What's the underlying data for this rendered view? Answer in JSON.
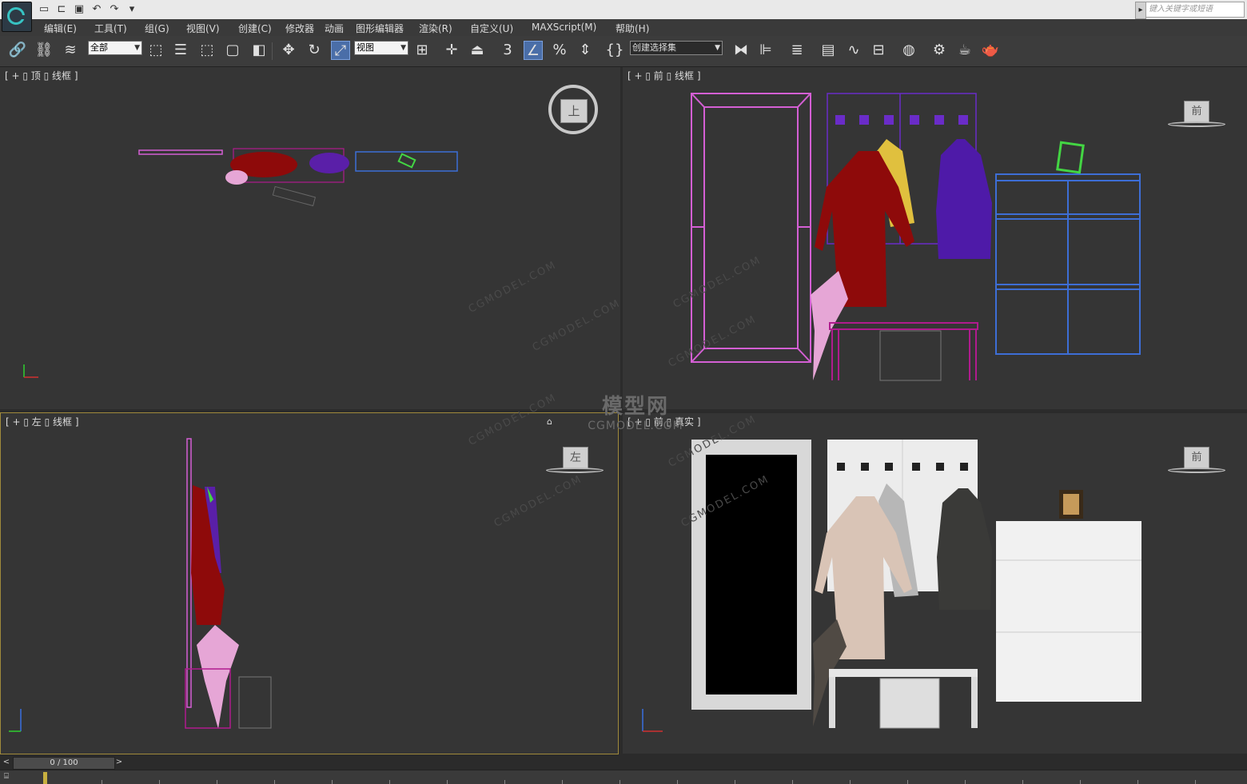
{
  "search": {
    "placeholder": "键入关键字或短语"
  },
  "menu": [
    "编辑(E)",
    "工具(T)",
    "组(G)",
    "视图(V)",
    "创建(C)",
    "修改器",
    "动画",
    "图形编辑器",
    "渲染(R)",
    "自定义(U)",
    "MAXScript(M)",
    "帮助(H)"
  ],
  "toolbar": {
    "selection_filter": "全部",
    "ref_coord": "视图",
    "named_selection": "创建选择集",
    "snap_label": "3"
  },
  "viewports": {
    "top": {
      "label": "[ + ▯ 顶 ▯ 线框 ]",
      "cube": "上"
    },
    "front": {
      "label": "[ + ▯ 前 ▯ 线框 ]",
      "cube": "前"
    },
    "left": {
      "label": "[ + ▯ 左 ▯ 线框 ]",
      "cube": "左"
    },
    "persp": {
      "label": "[ + ▯ 前 ▯ 真实 ]",
      "cube": "前"
    }
  },
  "watermark": {
    "text": "CGMODEL.COM",
    "logo_cn": "模型网",
    "logo_en": "CGMODEL.COM"
  },
  "timeline": {
    "frame": "0 / 100"
  },
  "colors": {
    "accent": "#a08a3b",
    "background": "#353535",
    "magenta": "#d45fd4",
    "blue": "#3d6ed6",
    "purple": "#5a1fa8",
    "red": "#8e0a0a"
  }
}
